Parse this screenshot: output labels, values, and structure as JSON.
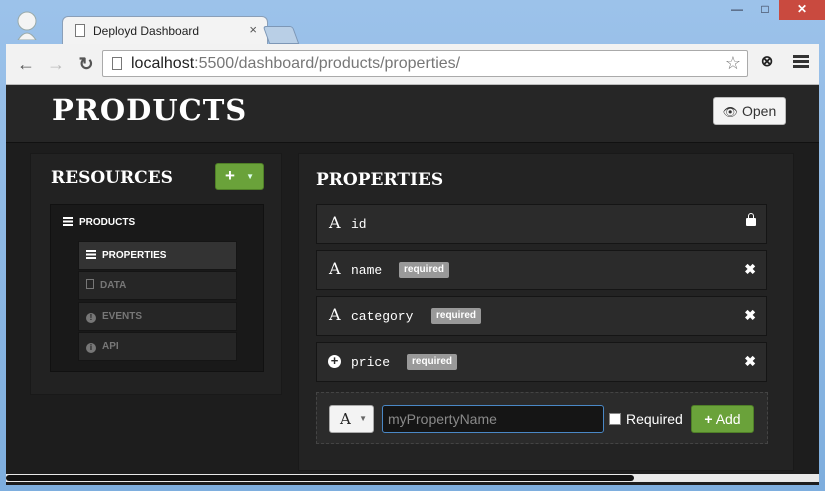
{
  "browser": {
    "tab_title": "Deployd Dashboard",
    "tab_close": "×",
    "window": {
      "minimize": "—",
      "maximize": "□",
      "close": "✕"
    },
    "nav": {
      "back": "←",
      "forward": "→",
      "reload": "↻"
    },
    "url_host": "localhost",
    "url_rest": ":5500/dashboard/products/properties/",
    "star": "☆"
  },
  "header": {
    "title": "PRODUCTS",
    "open_label": "Open"
  },
  "sidebar": {
    "title": "RESOURCES",
    "add_symbol": "+",
    "root": "PRODUCTS",
    "items": [
      {
        "label": "PROPERTIES"
      },
      {
        "label": "DATA"
      },
      {
        "label": "EVENTS"
      },
      {
        "label": "API"
      }
    ]
  },
  "properties": {
    "title": "PROPERTIES",
    "rows": [
      {
        "type_glyph": "A",
        "name": "id",
        "required": ""
      },
      {
        "type_glyph": "A",
        "name": "name",
        "required": "required"
      },
      {
        "type_glyph": "A",
        "name": "category",
        "required": "required"
      },
      {
        "type_glyph": "+",
        "name": "price",
        "required": "required"
      }
    ],
    "new": {
      "type_glyph": "A",
      "placeholder": "myPropertyName",
      "required_label": "Required",
      "add_label": "Add",
      "add_symbol": "+"
    }
  },
  "colors": {
    "accent_green": "#6aa23a",
    "background": "#1d1d1d"
  }
}
